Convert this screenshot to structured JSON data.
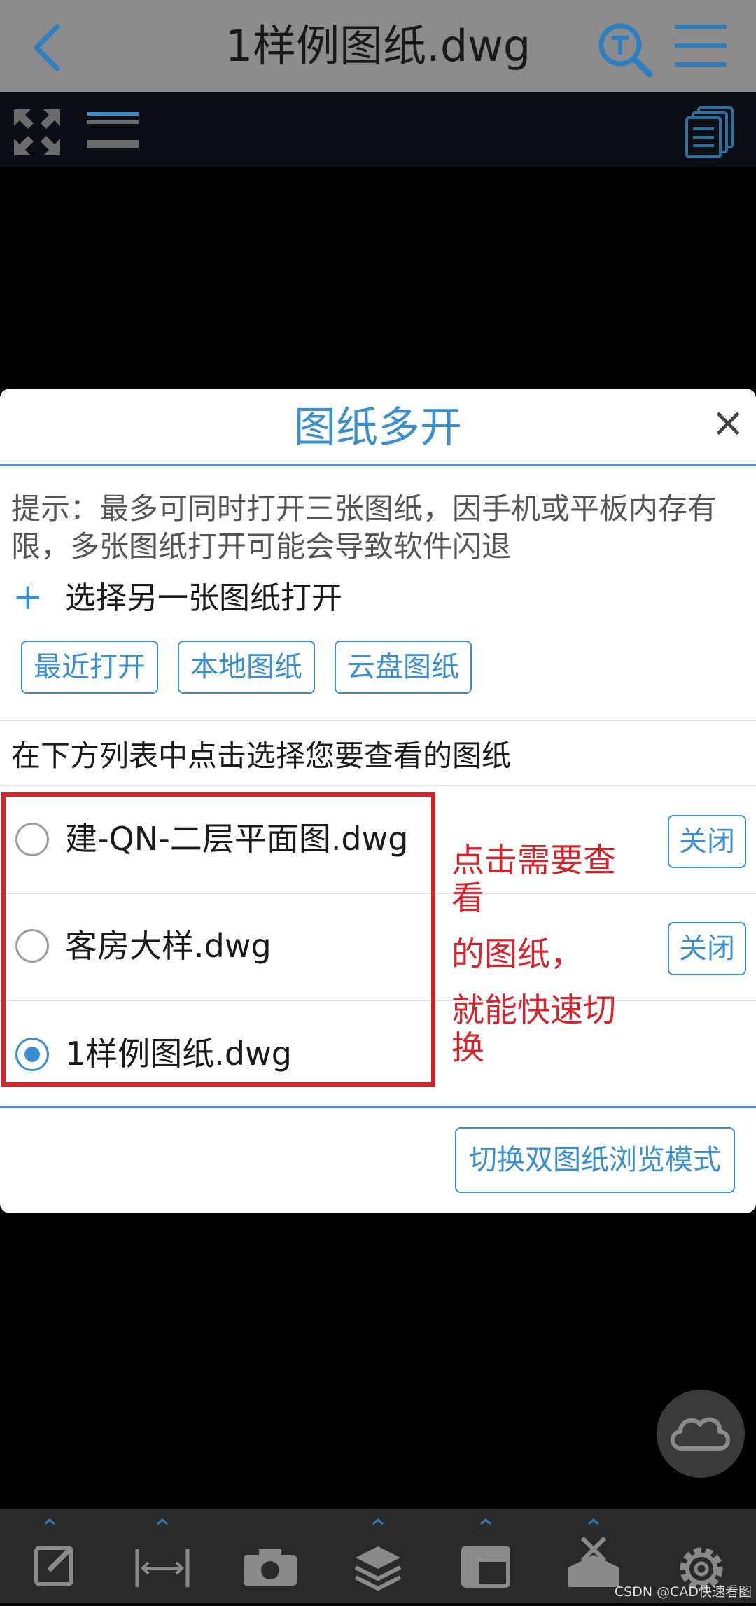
{
  "header": {
    "title": "1样例图纸.dwg",
    "back_icon": "chevron-left-icon",
    "search_icon": "text-search-icon",
    "menu_icon": "hamburger-menu-icon"
  },
  "toolbar": {
    "fullscreen_icon": "fullscreen-icon",
    "bars_icon": "bars-icon",
    "documents_icon": "multi-document-icon"
  },
  "dialog": {
    "title": "图纸多开",
    "close_label": "×",
    "hint": "提示：最多可同时打开三张图纸，因手机或平板内存有限，多张图纸打开可能会导致软件闪退",
    "add_symbol": "+",
    "pick_another": "选择另一张图纸打开",
    "source_buttons": [
      "最近打开",
      "本地图纸",
      "云盘图纸"
    ],
    "instruction": "在下方列表中点击选择您要查看的图纸",
    "files": [
      {
        "name": "建-QN-二层平面图.dwg",
        "selected": false,
        "close_label": "关闭"
      },
      {
        "name": "客房大样.dwg",
        "selected": false,
        "close_label": "关闭"
      },
      {
        "name": "1样例图纸.dwg",
        "selected": true,
        "close_label": ""
      }
    ],
    "annotation": [
      "点击需要查看",
      "的图纸，",
      "就能快速切换"
    ],
    "dual_mode_button": "切换双图纸浏览模式"
  },
  "floating": {
    "cloud_icon": "cloud-icon"
  },
  "bottom_toolbar": {
    "items": [
      "edit-icon",
      "measure-icon",
      "camera-icon",
      "layers-icon",
      "layout-icon",
      "tools-icon",
      "settings-icon"
    ]
  },
  "watermark": "CSDN @CAD快速看图",
  "colors": {
    "accent": "#3a8fd0",
    "annotation_red": "#d9232b",
    "topbar": "#8c8c8c"
  }
}
